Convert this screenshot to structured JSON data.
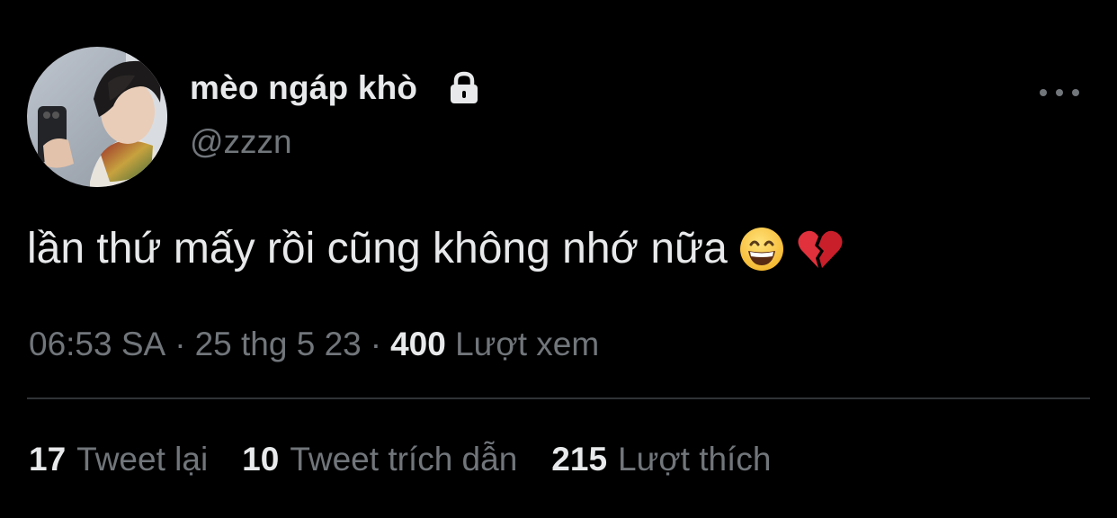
{
  "author": {
    "display_name": "mèo ngáp khò",
    "handle": "@zzzn",
    "avatar_icon": "profile-photo",
    "protected_icon": "lock-icon"
  },
  "tweet": {
    "text": "lần thứ mấy rồi cũng không nhớ nữa",
    "emojis": [
      "grinning-face-with-smiling-eyes",
      "broken-heart"
    ]
  },
  "meta": {
    "time": "06:53 SA",
    "separator": "·",
    "date": "25 thg 5 23",
    "views_count": "400",
    "views_label": "Lượt xem"
  },
  "stats": {
    "retweets_count": "17",
    "retweets_label": "Tweet lại",
    "quotes_count": "10",
    "quotes_label": "Tweet trích dẫn",
    "likes_count": "215",
    "likes_label": "Lượt thích"
  },
  "colors": {
    "background": "#000000",
    "primary_text": "#e7e9ea",
    "secondary_text": "#71767b",
    "divider": "#2f3336"
  }
}
